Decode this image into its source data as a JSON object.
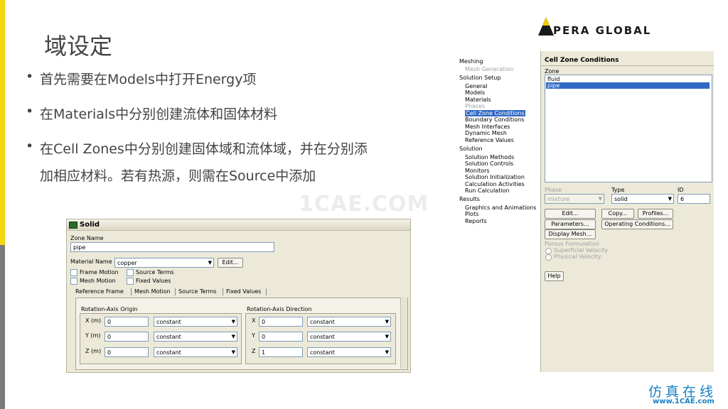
{
  "slide": {
    "title": "域设定",
    "bullets": [
      "首先需要在Models中打开Energy项",
      "在Materials中分别创建流体和固体材料",
      "在Cell Zones中分别创建固体域和流体域，并在分别添",
      "加相应材料。若有热源，则需在Source中添加"
    ],
    "bullet_symbol": "•",
    "watermark": "1CAE.COM",
    "logo_text": "PERA GLOBAL",
    "footer_cn": "仿真在线",
    "footer_url": "www.1CAE.com",
    "accent_colors": {
      "yellow": "#f2d60f",
      "gray": "#7a7a7a",
      "footer": "#1a7fc4"
    }
  },
  "solid_dialog": {
    "title": "Solid",
    "zone_name_label": "Zone Name",
    "zone_name_value": "pipe",
    "material_name_label": "Material Name",
    "material_value": "copper",
    "edit_button": "Edit...",
    "checkboxes": {
      "frame_motion": "Frame Motion",
      "source_terms": "Source Terms",
      "mesh_motion": "Mesh Motion",
      "fixed_values": "Fixed Values"
    },
    "tabs": [
      "Reference Frame",
      "Mesh Motion",
      "Source Terms",
      "Fixed Values"
    ],
    "origin": {
      "title": "Rotation-Axis Origin",
      "rows": [
        {
          "label": "X (m)",
          "value": "0",
          "method": "constant"
        },
        {
          "label": "Y (m)",
          "value": "0",
          "method": "constant"
        },
        {
          "label": "Z (m)",
          "value": "0",
          "method": "constant"
        }
      ]
    },
    "direction": {
      "title": "Rotation-Axis Direction",
      "rows": [
        {
          "label": "X",
          "value": "0",
          "method": "constant"
        },
        {
          "label": "Y",
          "value": "0",
          "method": "constant"
        },
        {
          "label": "Z",
          "value": "1",
          "method": "constant"
        }
      ]
    }
  },
  "fluent": {
    "tree": {
      "meshing": "Meshing",
      "mesh_generation": "Mesh Generation",
      "solution_setup": "Solution Setup",
      "setup_items": [
        "General",
        "Models",
        "Materials",
        "Phases",
        "Cell Zone Conditions",
        "Boundary Conditions",
        "Mesh Interfaces",
        "Dynamic Mesh",
        "Reference Values"
      ],
      "solution": "Solution",
      "solution_items": [
        "Solution Methods",
        "Solution Controls",
        "Monitors",
        "Solution Initialization",
        "Calculation Activities",
        "Run Calculation"
      ],
      "results": "Results",
      "results_items": [
        "Graphics and Animations",
        "Plots",
        "Reports"
      ]
    },
    "panel": {
      "title": "Cell Zone Conditions",
      "zone_label": "Zone",
      "zones": [
        "fluid",
        "pipe"
      ],
      "selected_zone": "pipe",
      "phase_label": "Phase",
      "phase_value": "mixture",
      "type_label": "Type",
      "type_value": "solid",
      "id_label": "ID",
      "id_value": "6",
      "buttons": {
        "edit": "Edit...",
        "copy": "Copy...",
        "profiles": "Profiles...",
        "parameters": "Parameters...",
        "operating": "Operating Conditions...",
        "display_mesh": "Display Mesh...",
        "help": "Help"
      },
      "porous_label": "Porous Formulation",
      "porous_options": [
        "Superficial Velocity",
        "Physical Velocity"
      ]
    }
  }
}
